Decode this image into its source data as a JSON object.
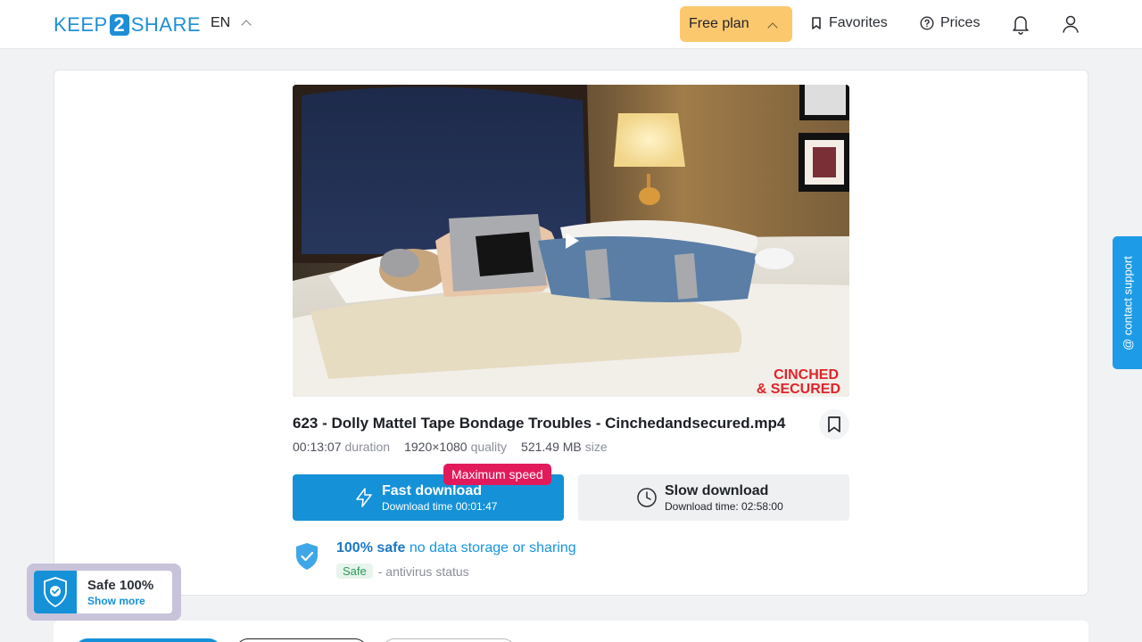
{
  "header": {
    "logo": {
      "left": "KEEP",
      "middle": "2",
      "right": "SHARE"
    },
    "language": "EN",
    "plan_label": "Free plan",
    "favorites_label": "Favorites",
    "prices_label": "Prices"
  },
  "file": {
    "title": "623 - Dolly Mattel Tape Bondage Troubles - Cinchedandsecured.mp4",
    "duration_value": "00:13:07",
    "duration_label": "duration",
    "quality_value": "1920×1080",
    "quality_label": "quality",
    "size_value": "521.49 MB",
    "size_label": "size",
    "watermark_line1": "CINCHED",
    "watermark_line2": "& SECURED"
  },
  "downloads": {
    "badge": "Maximum speed",
    "fast": {
      "label": "Fast download",
      "time": "Download time 00:01:47"
    },
    "slow": {
      "label": "Slow download",
      "time": "Download time: 02:58:00"
    }
  },
  "safety": {
    "strong": "100% safe",
    "text": "no data storage or sharing",
    "pill": "Safe",
    "status": "- antivirus status"
  },
  "support_tab": "@ contact support",
  "safe_widget": {
    "title": "Safe 100%",
    "link": "Show more"
  },
  "colors": {
    "accent": "#1591d8",
    "plan": "#fcc86e",
    "badge": "#e21a5c"
  }
}
